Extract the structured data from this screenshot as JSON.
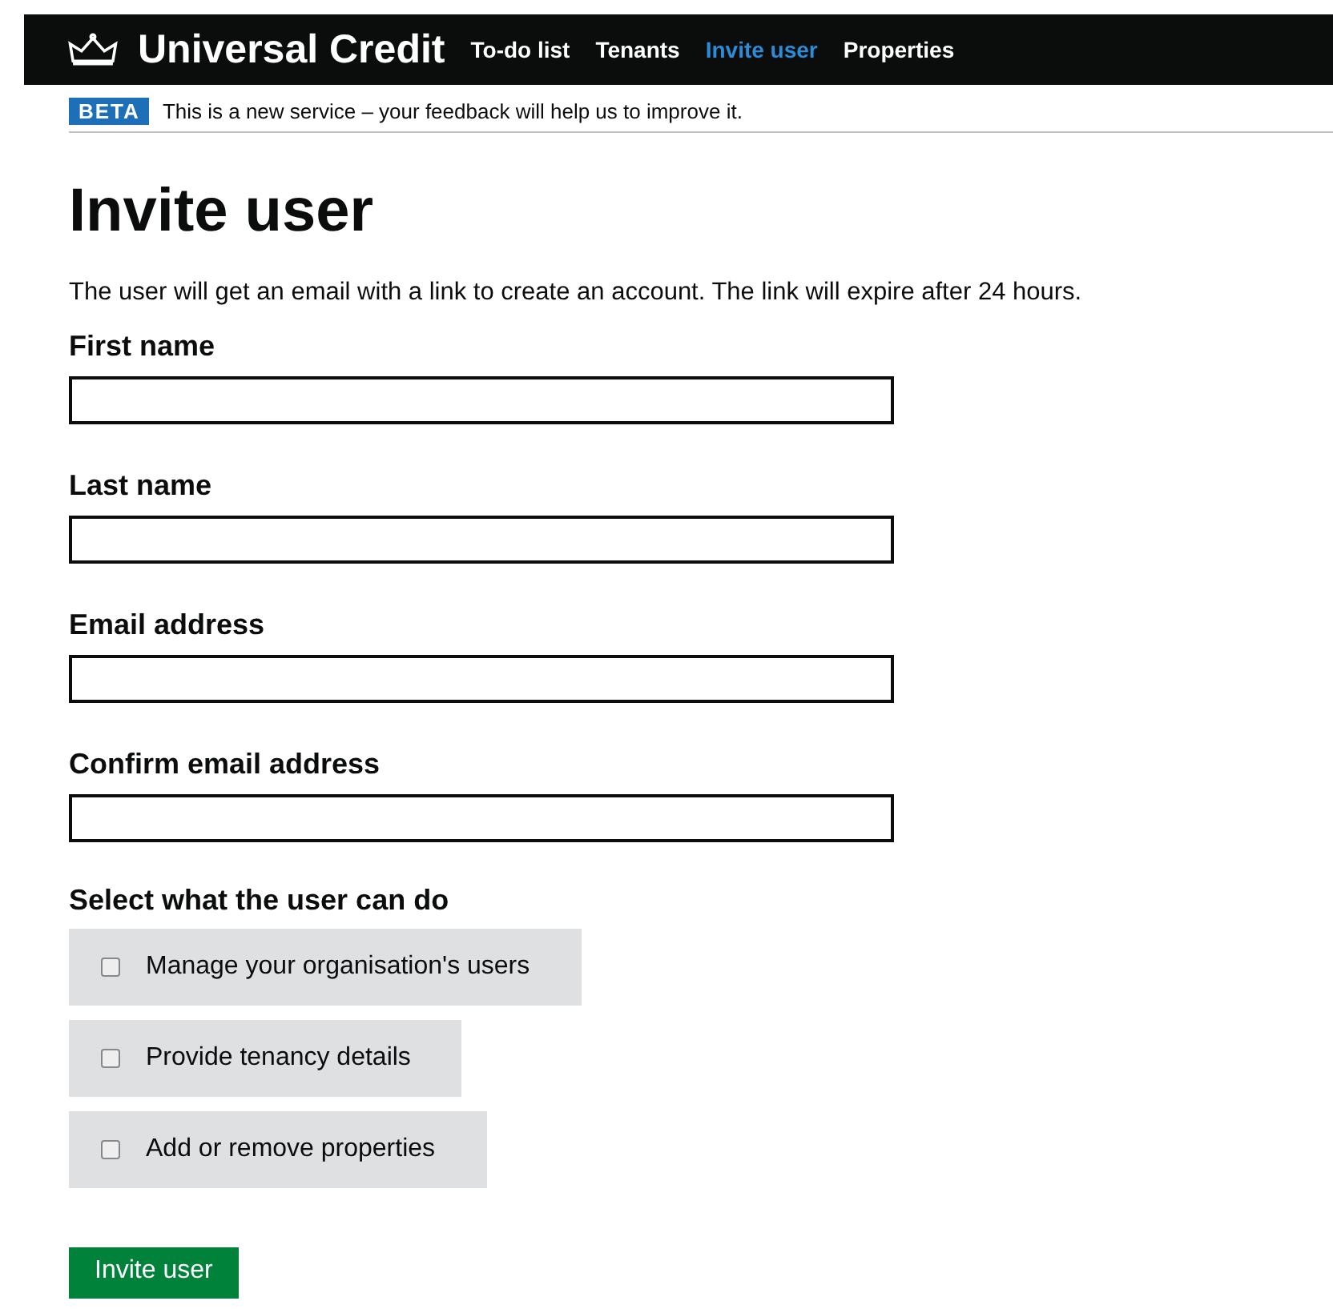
{
  "header": {
    "service_name": "Universal Credit",
    "nav": [
      {
        "label": "To-do list",
        "selected": false
      },
      {
        "label": "Tenants",
        "selected": false
      },
      {
        "label": "Invite user",
        "selected": true
      },
      {
        "label": "Properties",
        "selected": false
      }
    ]
  },
  "phase_banner": {
    "tag": "BETA",
    "text": "This is a new service – your feedback will help us to improve it."
  },
  "heading": "Invite user",
  "intro": "The user will get an email with a link to create an account. The link will expire after 24 hours.",
  "fields": [
    {
      "label": "First name"
    },
    {
      "label": "Last name"
    },
    {
      "label": "Email address"
    },
    {
      "label": "Confirm email address"
    }
  ],
  "permissions": {
    "legend": "Select what the user can do",
    "options": [
      {
        "label": "Manage your organisation's users",
        "checked": false
      },
      {
        "label": "Provide tenancy details",
        "checked": false
      },
      {
        "label": "Add or remove properties",
        "checked": false
      }
    ]
  },
  "submit": "Invite user"
}
